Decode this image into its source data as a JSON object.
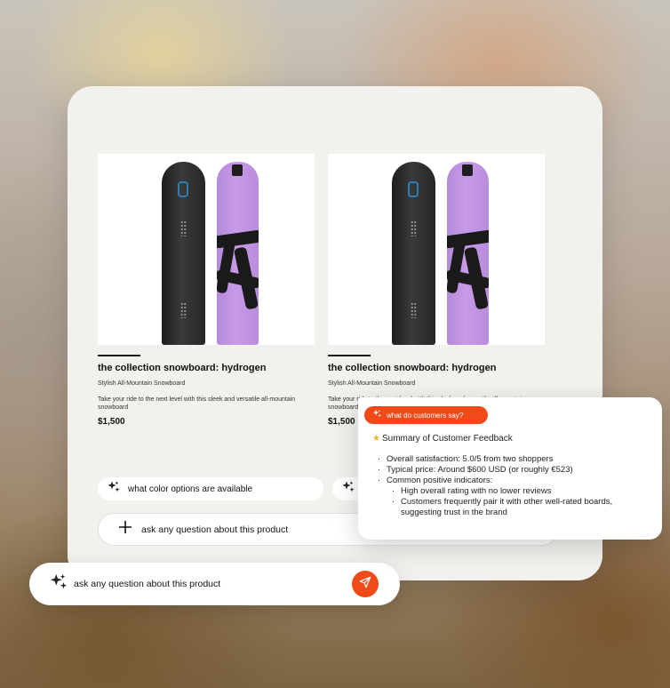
{
  "products": [
    {
      "title": "the collection snowboard: hydrogen",
      "subtitle": "Stylish All-Mountain Snowboard",
      "description": "Take your ride to the next level with this sleek and versatile all-mountain snowboard",
      "price": "$1,500"
    },
    {
      "title": "the collection snowboard: hydrogen",
      "subtitle": "Stylish All-Mountain Snowboard",
      "description": "Take your ride to the next level with this sleek and versatile all-mountain snowboard",
      "price": "$1,500"
    }
  ],
  "suggestions": [
    {
      "label": "what color options are available",
      "icon": "sparkle-icon"
    },
    {
      "label": "",
      "icon": "sparkle-icon"
    }
  ],
  "ask_inner": {
    "label": "ask any question about this product",
    "icon": "plus-icon"
  },
  "ask_outer": {
    "label": "ask any question about this product",
    "icon": "sparkle-icon",
    "send_icon": "send-icon"
  },
  "feedback": {
    "pill_label": "what do customers say?",
    "heading": "Summary of Customer Feedback",
    "items": [
      "Overall satisfaction: 5.0/5 from two shoppers",
      "Typical price: Around $600 USD (or roughly €523)",
      "Common positive indicators:"
    ],
    "sub_items": [
      "High overall rating with no lower reviews",
      "Customers frequently pair it with other well-rated boards, suggesting trust in the brand"
    ]
  },
  "colors": {
    "accent": "#f04a19",
    "card_bg": "#f3f1ee",
    "board_purple": "#c79ae8",
    "board_black": "#262626"
  }
}
